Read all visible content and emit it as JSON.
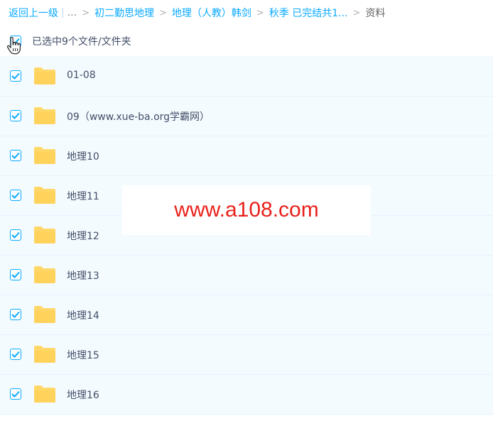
{
  "breadcrumb": {
    "back_label": "返回上一级",
    "separator": "|",
    "ellipsis": "...",
    "arrow": ">",
    "items": [
      "初二勤思地理",
      "地理（人教）韩剑",
      "秋季 已完结共1..."
    ],
    "current": "资料"
  },
  "list": {
    "header_text": "已选中9个文件/文件夹",
    "items": [
      {
        "name": "01-08",
        "checked": true
      },
      {
        "name": "09（www.xue-ba.org学霸网）",
        "checked": true
      },
      {
        "name": "地理10",
        "checked": true
      },
      {
        "name": "地理11",
        "checked": true
      },
      {
        "name": "地理12",
        "checked": true
      },
      {
        "name": "地理13",
        "checked": true
      },
      {
        "name": "地理14",
        "checked": true
      },
      {
        "name": "地理15",
        "checked": true
      },
      {
        "name": "地理16",
        "checked": true
      }
    ]
  },
  "watermark": {
    "text": "www.a108.com"
  },
  "colors": {
    "accent": "#09aaff",
    "row_bg": "#f4fbff",
    "folder": "#ffd766",
    "watermark": "#e8211b"
  },
  "icons": {
    "folder": "folder-icon",
    "checkbox": "checkbox-checked-icon",
    "cursor": "hand-cursor-icon"
  }
}
